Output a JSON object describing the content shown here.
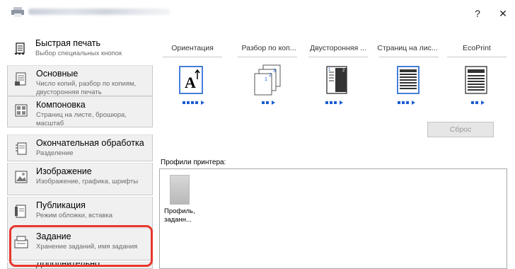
{
  "titlebar": {
    "help_label": "?",
    "close_label": "✕"
  },
  "sidebar": {
    "items": [
      {
        "title": "Быстрая печать",
        "subtitle": "Выбор специальных кнопок"
      },
      {
        "title": "Основные",
        "subtitle": "Число копий, разбор по копиям, двусторонняя печать"
      },
      {
        "title": "Компоновка",
        "subtitle": "Страниц на листе, брошюра, масштаб"
      },
      {
        "title": "Окончательная обработка",
        "subtitle": "Разделение"
      },
      {
        "title": "Изображение",
        "subtitle": "Изображение, графика, шрифты"
      },
      {
        "title": "Публикация",
        "subtitle": "Режим обложки, вставка"
      },
      {
        "title": "Задание",
        "subtitle": "Хранение заданий, имя задания"
      },
      {
        "title": "Дополнительно",
        "subtitle": ""
      }
    ]
  },
  "quick_print": {
    "columns": [
      {
        "label": "Ориентация",
        "icon": "orientation-icon"
      },
      {
        "label": "Разбор по коп...",
        "icon": "collate-icon"
      },
      {
        "label": "Двусторонняя ...",
        "icon": "duplex-icon"
      },
      {
        "label": "Страниц на лис...",
        "icon": "pages-per-sheet-icon"
      },
      {
        "label": "EcoPrint",
        "icon": "ecoprint-icon"
      }
    ],
    "reset_label": "Сброс"
  },
  "profiles": {
    "label": "Профили принтера:",
    "items": [
      {
        "name": "Профиль, заданн..."
      }
    ]
  },
  "colors": {
    "highlight": "#e8372e",
    "accent_blue": "#1a5fd0"
  }
}
